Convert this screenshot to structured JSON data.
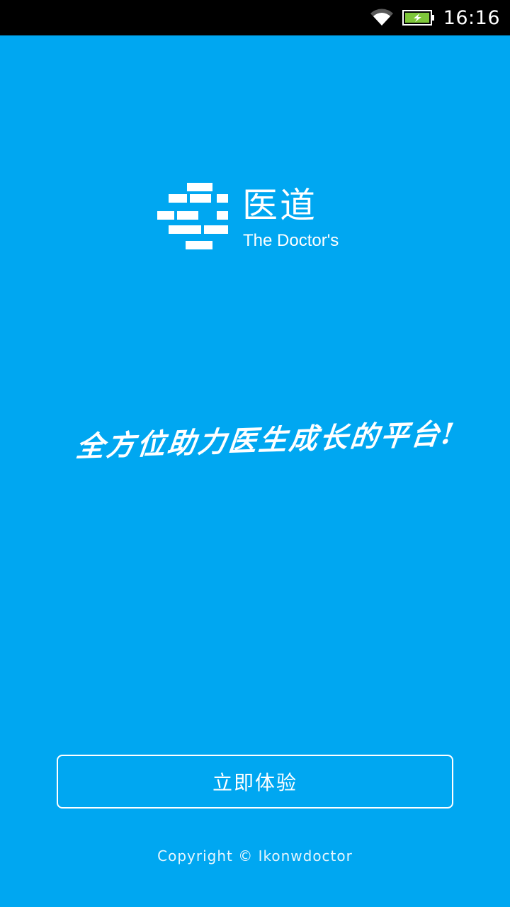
{
  "status_bar": {
    "time": "16:16",
    "wifi_icon": "wifi-icon",
    "battery_icon": "battery-charging-icon",
    "battery_color": "#7ec73a"
  },
  "logo": {
    "cn": "医道",
    "en": "The Doctor's"
  },
  "slogan": "全方位助力医生成长的平台!",
  "button": {
    "label": "立即体验"
  },
  "copyright": "Copyright © Ikonwdoctor",
  "colors": {
    "background": "#00a7f1",
    "status_bar": "#000000",
    "text": "#ffffff"
  }
}
